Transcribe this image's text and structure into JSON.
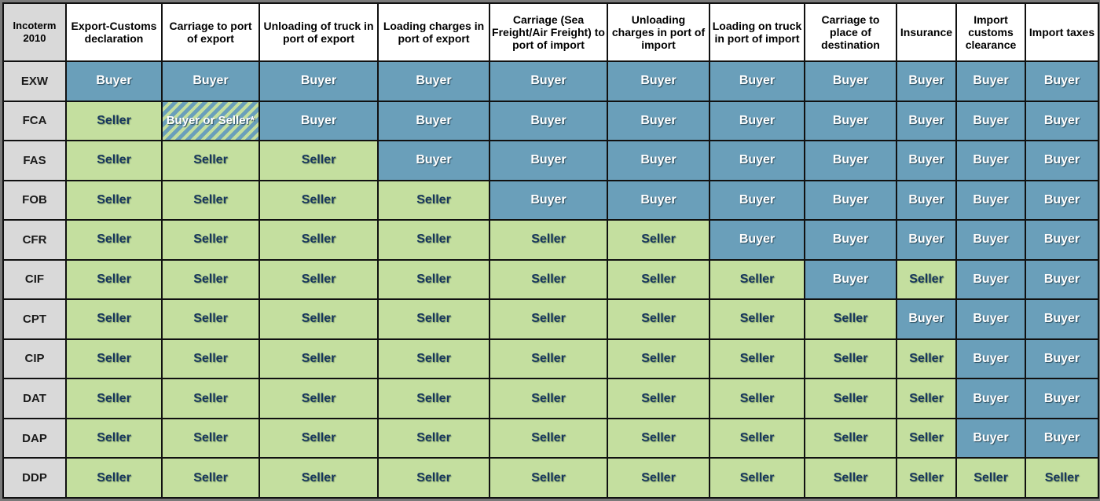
{
  "table": {
    "corner_header": "Incoterm 2010",
    "columns": [
      "Export-Customs declaration",
      "Carriage to port of export",
      "Unloading of truck in port of export",
      "Loading charges in port of export",
      "Carriage (Sea Freight/Air Freight) to port of import",
      "Unloading charges in port of import",
      "Loading on truck in port of import",
      "Carriage to place of destination",
      "Insurance",
      "Import customs clearance",
      "Import taxes"
    ],
    "rows": [
      {
        "term": "EXW",
        "cells": [
          "Buyer",
          "Buyer",
          "Buyer",
          "Buyer",
          "Buyer",
          "Buyer",
          "Buyer",
          "Buyer",
          "Buyer",
          "Buyer",
          "Buyer"
        ]
      },
      {
        "term": "FCA",
        "cells": [
          "Seller",
          "Buyer or Seller*",
          "Buyer",
          "Buyer",
          "Buyer",
          "Buyer",
          "Buyer",
          "Buyer",
          "Buyer",
          "Buyer",
          "Buyer"
        ]
      },
      {
        "term": "FAS",
        "cells": [
          "Seller",
          "Seller",
          "Seller",
          "Buyer",
          "Buyer",
          "Buyer",
          "Buyer",
          "Buyer",
          "Buyer",
          "Buyer",
          "Buyer"
        ]
      },
      {
        "term": "FOB",
        "cells": [
          "Seller",
          "Seller",
          "Seller",
          "Seller",
          "Buyer",
          "Buyer",
          "Buyer",
          "Buyer",
          "Buyer",
          "Buyer",
          "Buyer"
        ]
      },
      {
        "term": "CFR",
        "cells": [
          "Seller",
          "Seller",
          "Seller",
          "Seller",
          "Seller",
          "Seller",
          "Buyer",
          "Buyer",
          "Buyer",
          "Buyer",
          "Buyer"
        ]
      },
      {
        "term": "CIF",
        "cells": [
          "Seller",
          "Seller",
          "Seller",
          "Seller",
          "Seller",
          "Seller",
          "Seller",
          "Buyer",
          "Seller",
          "Buyer",
          "Buyer"
        ]
      },
      {
        "term": "CPT",
        "cells": [
          "Seller",
          "Seller",
          "Seller",
          "Seller",
          "Seller",
          "Seller",
          "Seller",
          "Seller",
          "Buyer",
          "Buyer",
          "Buyer"
        ]
      },
      {
        "term": "CIP",
        "cells": [
          "Seller",
          "Seller",
          "Seller",
          "Seller",
          "Seller",
          "Seller",
          "Seller",
          "Seller",
          "Seller",
          "Buyer",
          "Buyer"
        ]
      },
      {
        "term": "DAT",
        "cells": [
          "Seller",
          "Seller",
          "Seller",
          "Seller",
          "Seller",
          "Seller",
          "Seller",
          "Seller",
          "Seller",
          "Buyer",
          "Buyer"
        ]
      },
      {
        "term": "DAP",
        "cells": [
          "Seller",
          "Seller",
          "Seller",
          "Seller",
          "Seller",
          "Seller",
          "Seller",
          "Seller",
          "Seller",
          "Buyer",
          "Buyer"
        ]
      },
      {
        "term": "DDP",
        "cells": [
          "Seller",
          "Seller",
          "Seller",
          "Seller",
          "Seller",
          "Seller",
          "Seller",
          "Seller",
          "Seller",
          "Seller",
          "Seller"
        ]
      }
    ],
    "colors": {
      "buyer": "#6a9fba",
      "seller": "#c4df9f",
      "header": "#ffffff",
      "term_column": "#d9d9d9"
    }
  }
}
